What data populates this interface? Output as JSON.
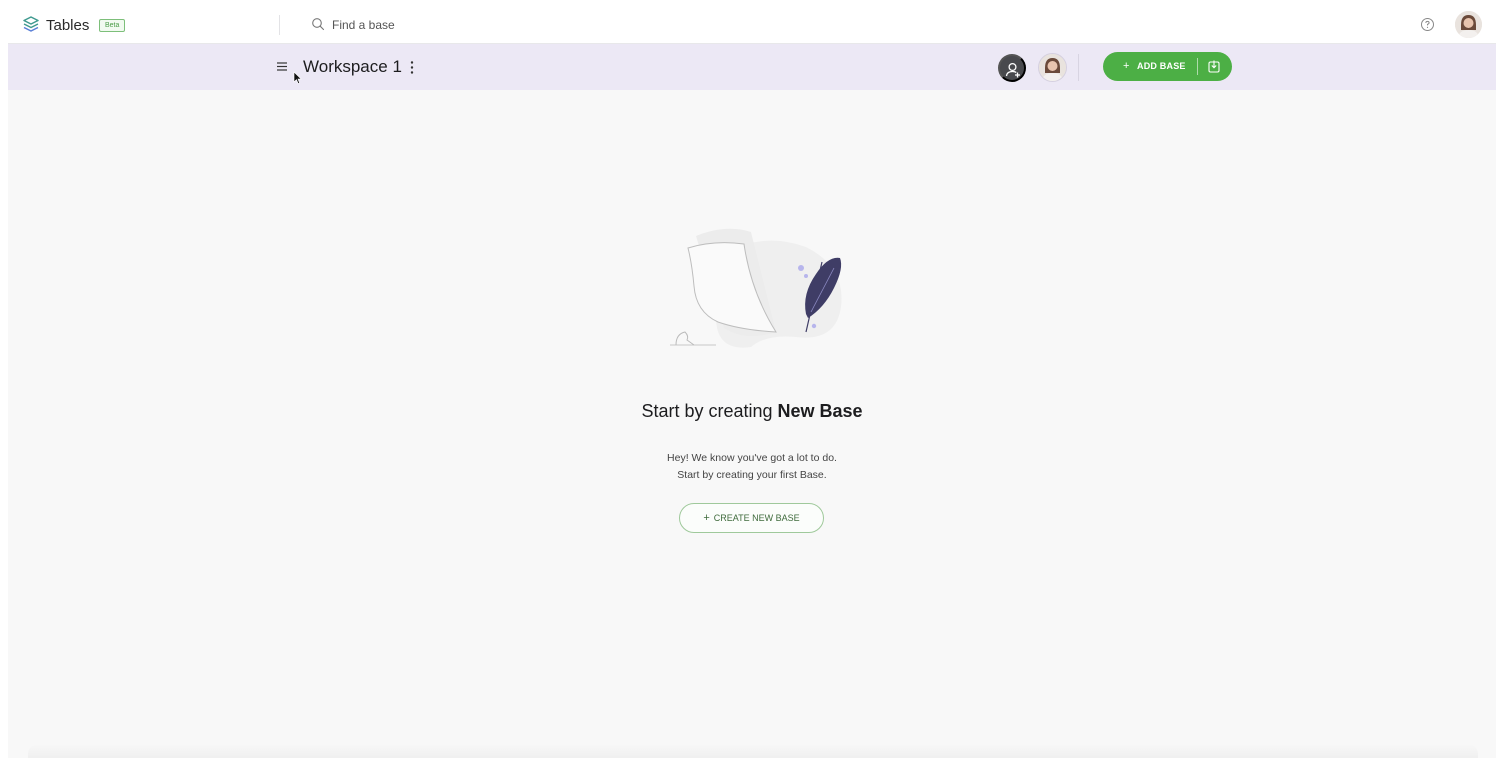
{
  "app": {
    "name": "Tables",
    "badge": "Beta",
    "logo_icon": "tables-logo-icon"
  },
  "search": {
    "placeholder": "Find a base",
    "value": "",
    "icon": "search-icon"
  },
  "topbar_right": {
    "help_icon": "help-icon",
    "avatar": "user-avatar"
  },
  "workspace": {
    "menu_icon": "hamburger-menu-icon",
    "title": "Workspace 1",
    "more_icon": "vertical-dots-icon",
    "add_member_icon": "add-user-icon",
    "member_avatar": "member-avatar",
    "add_base_label": "ADD BASE",
    "import_icon": "import-icon"
  },
  "empty_state": {
    "heading_prefix": "Start by creating",
    "heading_bold": "New Base",
    "desc_line1": "Hey! We know you've got a lot to do.",
    "desc_line2": "Start by creating your first Base.",
    "cta_label": "CREATE NEW BASE"
  },
  "colors": {
    "accent_green": "#4caf45",
    "workspace_bar": "#ece8f5",
    "background": "#f8f8f8",
    "illustration_purple": "#3f3d66"
  }
}
